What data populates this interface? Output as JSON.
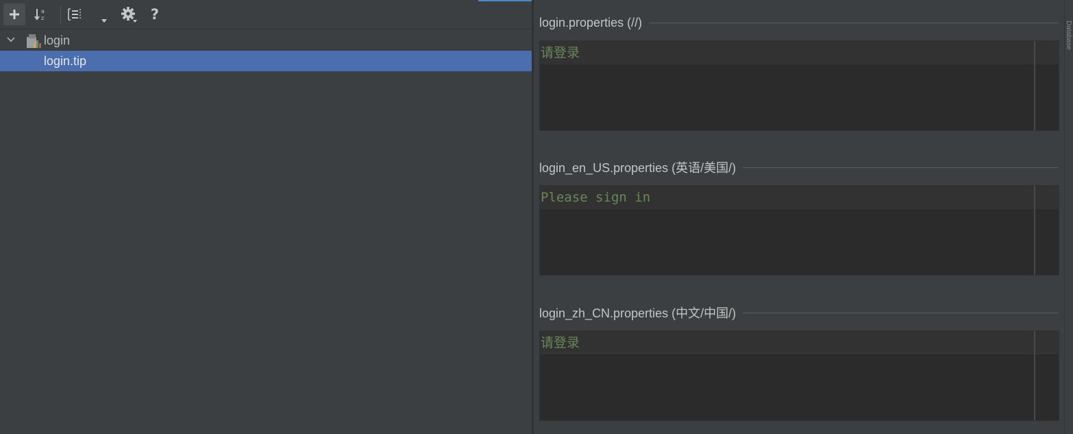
{
  "toolbar": {
    "add_icon": "plus-icon",
    "sort_icon": "sort-alphabetically-icon",
    "group_icon": "group-by-icon",
    "settings_icon": "gear-icon",
    "help_icon": "question-icon"
  },
  "tree": {
    "root_label": "login",
    "root_icon": "resource-bundle-icon",
    "children": [
      {
        "label": "login.tip",
        "selected": true
      }
    ]
  },
  "sections": [
    {
      "title": "login.properties (//)",
      "value": "请登录"
    },
    {
      "title": "login_en_US.properties (英语/美国/)",
      "value": "Please sign in"
    },
    {
      "title": "login_zh_CN.properties (中文/中国/)",
      "value": "请登录"
    }
  ],
  "colors": {
    "selection": "#4b6eaf",
    "string_value": "#6a8759",
    "editor_bg": "#2b2b2b",
    "panel_bg": "#3c3f41"
  },
  "right_strip_label": "Database"
}
